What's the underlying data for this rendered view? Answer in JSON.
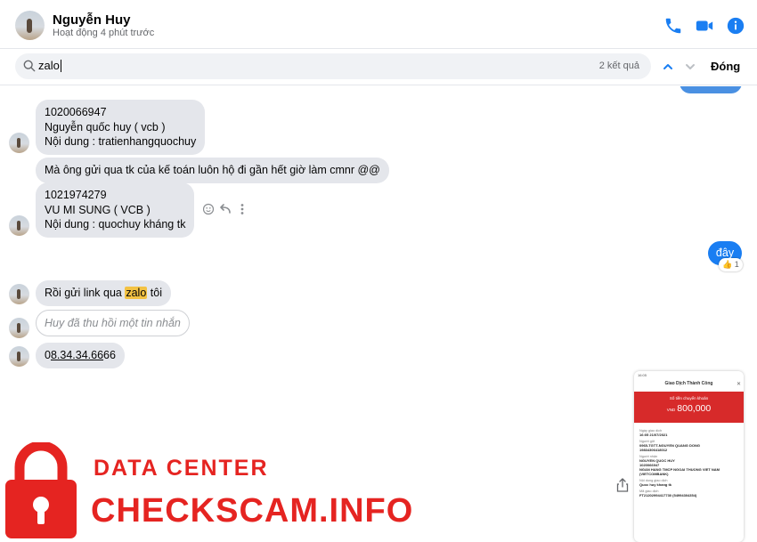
{
  "header": {
    "contact_name": "Nguyễn Huy",
    "status": "Hoạt động 4 phút trước",
    "icons": [
      "phone-icon",
      "video-camera-icon",
      "info-icon"
    ],
    "accent_color": "#1a7ef2"
  },
  "search": {
    "query": "zalo",
    "result_count": "2 kết quả",
    "close_label": "Đóng"
  },
  "messages": {
    "msg1": [
      "1020066947",
      "Nguyễn quốc huy ( vcb )",
      "Nội dung : tratienhangquochuy"
    ],
    "msg2": "Mà ông gửi qua tk của kế toán luôn hộ đi gần hết giờ làm cmnr @@",
    "msg3": [
      "1021974279",
      "VU MI SUNG ( VCB )",
      "Nội dung : quochuy kháng tk"
    ],
    "mine": "đây",
    "mine_reaction": "👍",
    "mine_reaction_count": "1",
    "msg4_before": "Rồi gửi link qua ",
    "msg4_highlight": "zalo",
    "msg4_after": " tôi",
    "unsent": "Huy đã thu hồi một tin nhắn",
    "phone_pre": "0",
    "phone_link": "8.34.34.66",
    "phone_post": "66"
  },
  "receipt": {
    "status_bar": "16:05",
    "title": "Giao Dịch Thành Công",
    "amount_label": "Số tiền chuyển khoản",
    "currency": "VND",
    "amount": "800,000",
    "rows": [
      {
        "label": "Ngày giao dịch",
        "value": "16:05 21/07/2021"
      },
      {
        "label": "Người gửi",
        "value": "0965-TGTT-NGUYEN QUANG DONG"
      },
      {
        "label": "",
        "value": "19834306418012"
      },
      {
        "label": "Người nhận",
        "value": "NGUYEN QUOC HUY"
      },
      {
        "label": "",
        "value": "1020066947"
      },
      {
        "label": "",
        "value": "NGAN HANG TMCP NGOAI THUONG VIET NAM"
      },
      {
        "label": "",
        "value": "(VIETCOMBANK)"
      },
      {
        "label": "Nội dung giao dịch",
        "value": "Quoc huy khang tk"
      },
      {
        "label": "Mã giao dịch",
        "value": "FT21202994417730 (54994304354)"
      }
    ]
  },
  "watermark": {
    "line1": "DATA CENTER",
    "line2": "CHECKSCAM.INFO",
    "color": "#e52421"
  }
}
